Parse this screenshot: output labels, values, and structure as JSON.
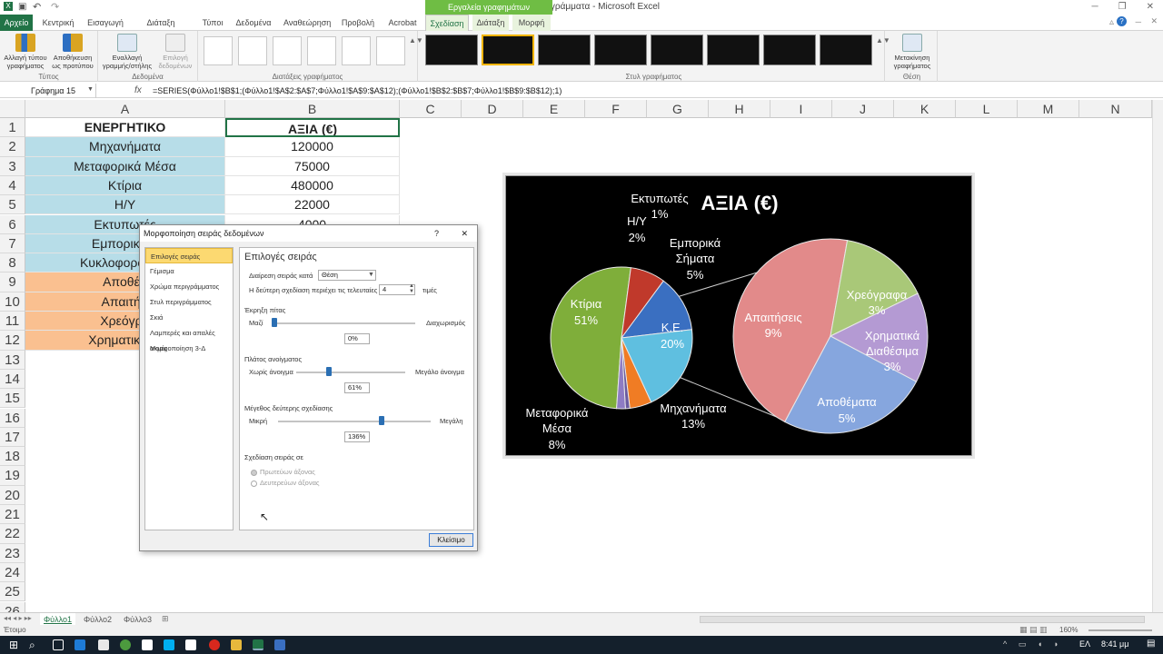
{
  "window": {
    "title": "Κυκλικά Διαγράμματα - Microsoft Excel",
    "context_tab_group": "Εργαλεία γραφημάτων"
  },
  "tabs": [
    "Αρχείο",
    "Κεντρική",
    "Εισαγωγή",
    "Διάταξη σελίδας",
    "Τύποι",
    "Δεδομένα",
    "Αναθεώρηση",
    "Προβολή",
    "Acrobat",
    "Σχεδίαση",
    "Διάταξη",
    "Μορφή"
  ],
  "ribbon": {
    "change_type": "Αλλαγή τύπου γραφήματος",
    "save_template": "Αποθήκευση ως προτύπου",
    "group_type": "Τύπος",
    "switch_rowcol": "Εναλλαγή γραμμής/στήλης",
    "select_data": "Επιλογή δεδομένων",
    "group_data": "Δεδομένα",
    "group_layouts": "Διατάξεις γραφήματος",
    "group_styles": "Στυλ γραφήματος",
    "move_chart": "Μετακίνηση γραφήματος",
    "group_location": "Θέση"
  },
  "formula_bar": {
    "name_box": "Γράφημα 15",
    "fx": "fx",
    "formula": "=SERIES(Φύλλο1!$B$1;(Φύλλο1!$A$2:$A$7;Φύλλο1!$A$9:$A$12);(Φύλλο1!$B$2:$B$7;Φύλλο1!$B$9:$B$12);1)"
  },
  "columns": [
    "A",
    "B",
    "C",
    "D",
    "E",
    "F",
    "G",
    "H",
    "I",
    "J",
    "K",
    "L",
    "M",
    "N"
  ],
  "rows": [
    "1",
    "2",
    "3",
    "4",
    "5",
    "6",
    "7",
    "8",
    "9",
    "10",
    "11",
    "12",
    "13",
    "14",
    "15",
    "16",
    "17",
    "18",
    "19",
    "20",
    "21",
    "22",
    "23",
    "24",
    "25",
    "26"
  ],
  "sheet": {
    "header": [
      "ΕΝΕΡΓΗΤΙΚΟ",
      "ΑΞΙΑ (€)"
    ],
    "rows": [
      {
        "a": "Μηχανήματα",
        "b": "120000",
        "color": "blue"
      },
      {
        "a": "Μεταφορικά Μέσα",
        "b": "75000",
        "color": "blue"
      },
      {
        "a": "Κτίρια",
        "b": "480000",
        "color": "blue"
      },
      {
        "a": "Η/Υ",
        "b": "22000",
        "color": "blue"
      },
      {
        "a": "Εκτυπωτές",
        "b": "4000",
        "color": "blue"
      },
      {
        "a": "Εμπορικά Σ",
        "b": "",
        "color": "blue"
      },
      {
        "a": "Κυκλοφορούν Ε",
        "b": "",
        "color": "blue"
      },
      {
        "a": "Αποθέμ",
        "b": "",
        "color": "orange"
      },
      {
        "a": "Απαιτήσ",
        "b": "",
        "color": "orange"
      },
      {
        "a": "Χρεόγρα",
        "b": "",
        "color": "orange"
      },
      {
        "a": "Χρηματικά Δι",
        "b": "",
        "color": "orange"
      }
    ]
  },
  "chart_data": {
    "type": "pie",
    "title": "ΑΞΙΑ (€)",
    "primary": [
      {
        "label": "Κτίρια",
        "value": 51,
        "color": "#7fae3a"
      },
      {
        "label": "Μεταφορικά Μέσα",
        "value": 8,
        "color": "#c0392b"
      },
      {
        "label": "Μηχανήματα",
        "value": 13,
        "color": "#3a6fc1"
      },
      {
        "label": "Κ.Ε.",
        "value": 20,
        "color": "#5fbfe0"
      },
      {
        "label": "Εμπορικά Σήματα",
        "value": 5,
        "color": "#f07c24"
      },
      {
        "label": "Εκτυπωτές",
        "value": 1,
        "color": "#6a5a9f"
      },
      {
        "label": "Η/Υ",
        "value": 2,
        "color": "#8e7cc3"
      }
    ],
    "secondary": [
      {
        "label": "Απαιτήσεις",
        "value": 9,
        "color": "#e28a8a"
      },
      {
        "label": "Χρεόγραφα",
        "value": 3,
        "color": "#a9c878"
      },
      {
        "label": "Χρηματικά Διαθέσιμα",
        "value": 3,
        "color": "#b49ad3"
      },
      {
        "label": "Αποθέματα",
        "value": 5,
        "color": "#86a6de"
      }
    ],
    "labels": {
      "ktiria_name": "Κτίρια",
      "ktiria_pct": "51%",
      "metaf_1": "Μεταφορικά",
      "metaf_2": "Μέσα",
      "metaf_pct": "8%",
      "mix_name": "Μηχανήματα",
      "mix_pct": "13%",
      "ke_name": "Κ.Ε.",
      "ke_pct": "20%",
      "emp_1": "Εμπορικά",
      "emp_2": "Σήματα",
      "emp_pct": "5%",
      "ekt_name": "Εκτυπωτές",
      "ekt_pct": "1%",
      "hy_name": "Η/Υ",
      "hy_pct": "2%",
      "apait_name": "Απαιτήσεις",
      "apait_pct": "9%",
      "xreo_name": "Χρεόγραφα",
      "xreo_pct": "3%",
      "xrim_1": "Χρηματικά",
      "xrim_2": "Διαθέσιμα",
      "xrim_pct": "3%",
      "apoth_name": "Αποθέματα",
      "apoth_pct": "5%"
    }
  },
  "dialog": {
    "title": "Μορφοποίηση σειράς δεδομένων",
    "help": "?",
    "close_x": "✕",
    "nav": [
      "Επιλογές σειράς",
      "Γέμισμα",
      "Χρώμα περιγράμματος",
      "Στυλ περιγράμματος",
      "Σκιά",
      "Λαμπερές και απαλές ακμές",
      "Μορφοποίηση 3-Δ"
    ],
    "section_title": "Επιλογές σειράς",
    "split_label": "Διαίρεση σειράς κατά",
    "split_value": "Θέση",
    "second_plot_label": "Η δεύτερη σχεδίαση περιέχει τις τελευταίες",
    "second_plot_value": "4",
    "second_plot_unit": "τιμές",
    "explosion_title": "Έκρηξη πίτας",
    "explosion_min": "Μαζί",
    "explosion_max": "Διαχωρισμός",
    "explosion_value": "0%",
    "explosion_level": 0,
    "gap_title": "Πλάτος ανοίγματος",
    "gap_min": "Χωρίς άνοιγμα",
    "gap_max": "Μεγάλο άνοιγμα",
    "gap_value": "61%",
    "gap_level": 0.3,
    "size_title": "Μέγεθος δεύτερης σχεδίασης",
    "size_min": "Μικρή",
    "size_max": "Μεγάλη",
    "size_value": "136%",
    "size_level": 0.68,
    "plot_on_title": "Σχεδίαση σειράς σε",
    "primary_axis": "Πρωτεύων άξονας",
    "secondary_axis": "Δευτερεύων άξονας",
    "close_button": "Κλείσιμο"
  },
  "sheet_tabs": [
    "Φύλλο1",
    "Φύλλο2",
    "Φύλλο3"
  ],
  "status": {
    "ready": "Έτοιμο",
    "zoom": "160%"
  },
  "taskbar": {
    "lang": "ΕΛ",
    "time": "8:41 μμ"
  }
}
